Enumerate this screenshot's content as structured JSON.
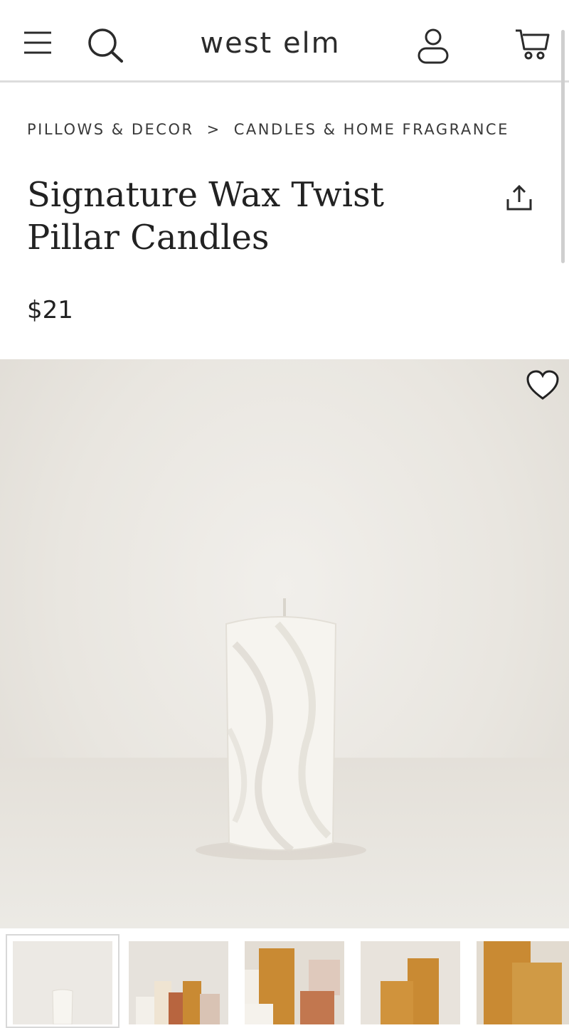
{
  "header": {
    "logo": "west elm",
    "icons": [
      "menu-icon",
      "search-icon",
      "account-icon",
      "cart-icon"
    ]
  },
  "breadcrumb": {
    "items": [
      "PILLOWS & DECOR",
      "CANDLES & HOME FRAGRANCE"
    ],
    "separator": ">"
  },
  "product": {
    "title": "Signature Wax Twist Pillar Candles",
    "price": "$21"
  },
  "gallery": {
    "thumbnail_count": 5,
    "selected_index": 0
  },
  "colors": {
    "text": "#2b2b2b",
    "candle_white": "#f5f3ee",
    "candle_amber": "#c98a33",
    "candle_terracotta": "#b5603c",
    "background": "#ebe8e2"
  }
}
